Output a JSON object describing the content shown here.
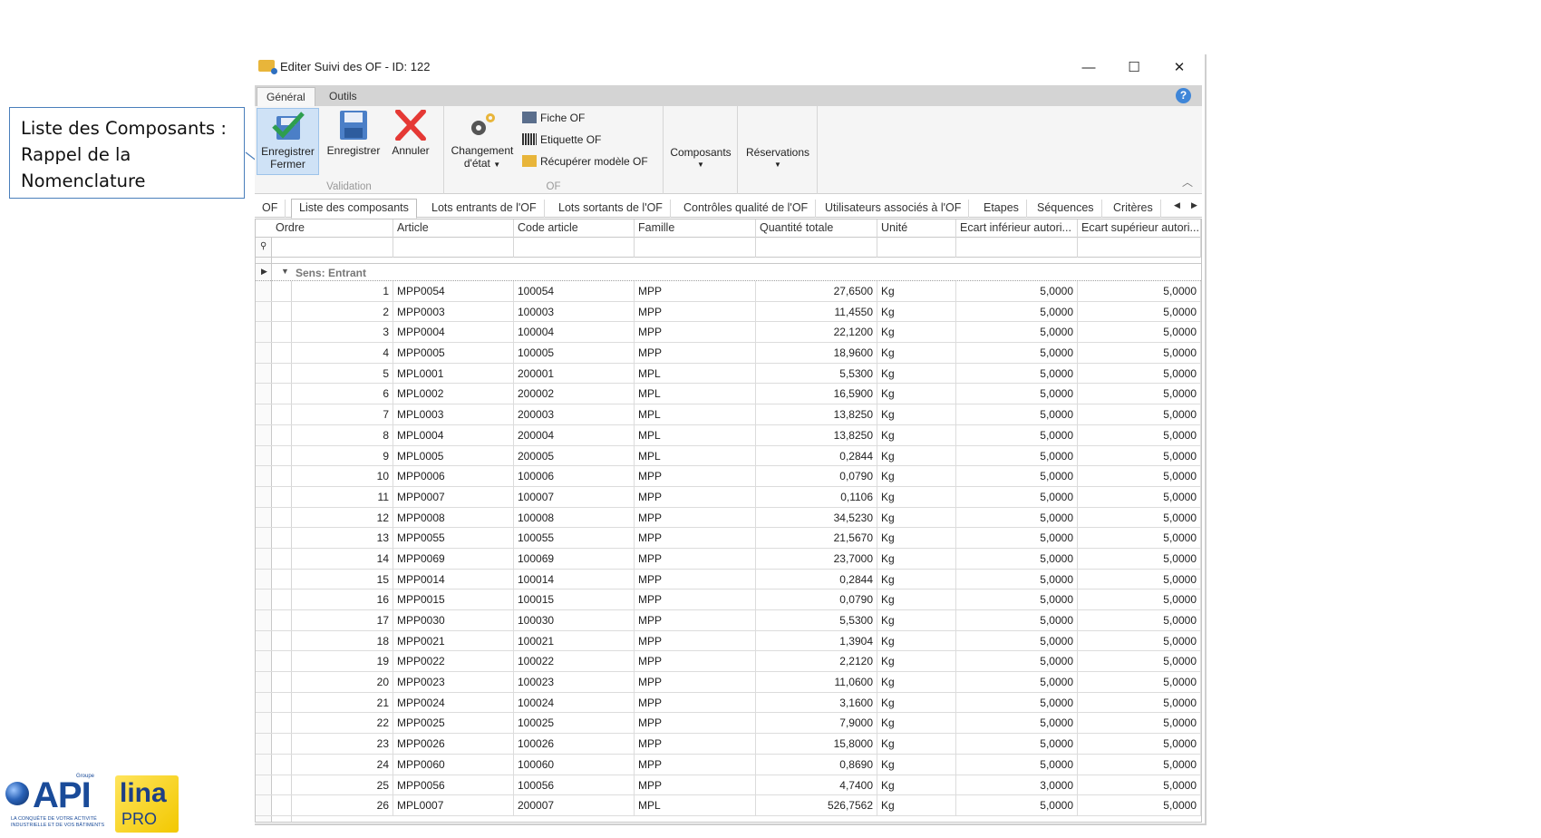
{
  "callout": {
    "line1": "Liste des Composants :",
    "line2": "Rappel de la",
    "line3": "Nomenclature"
  },
  "window": {
    "title": "Editer Suivi des OF - ID: 122",
    "minimize": "—",
    "maximize": "☐",
    "close": "✕"
  },
  "ribbon_tabs": [
    "Général",
    "Outils"
  ],
  "ribbon": {
    "save_close_l1": "Enregistrer",
    "save_close_l2": "Fermer",
    "save": "Enregistrer",
    "cancel": "Annuler",
    "validation_group": "Validation",
    "change_state_l1": "Changement",
    "change_state_l2": "d'état",
    "fiche_of": "Fiche OF",
    "etiquette_of": "Etiquette OF",
    "recuperer": "Récupérer modèle OF",
    "of_group": "OF",
    "composants": "Composants",
    "reservations": "Réservations"
  },
  "page_tabs": [
    "OF",
    "Liste des composants",
    "Lots entrants de l'OF",
    "Lots sortants de l'OF",
    "Contrôles qualité de l'OF",
    "Utilisateurs associés à l'OF",
    "Etapes",
    "Séquences",
    "Critères"
  ],
  "grid": {
    "columns": [
      "Ordre",
      "Article",
      "Code article",
      "Famille",
      "Quantité totale",
      "Unité",
      "Ecart inférieur autori...",
      "Ecart supérieur autori..."
    ],
    "group_label": "Sens: Entrant",
    "rows": [
      [
        "1",
        "MPP0054",
        "100054",
        "MPP",
        "27,6500",
        "Kg",
        "5,0000",
        "5,0000"
      ],
      [
        "2",
        "MPP0003",
        "100003",
        "MPP",
        "11,4550",
        "Kg",
        "5,0000",
        "5,0000"
      ],
      [
        "3",
        "MPP0004",
        "100004",
        "MPP",
        "22,1200",
        "Kg",
        "5,0000",
        "5,0000"
      ],
      [
        "4",
        "MPP0005",
        "100005",
        "MPP",
        "18,9600",
        "Kg",
        "5,0000",
        "5,0000"
      ],
      [
        "5",
        "MPL0001",
        "200001",
        "MPL",
        "5,5300",
        "Kg",
        "5,0000",
        "5,0000"
      ],
      [
        "6",
        "MPL0002",
        "200002",
        "MPL",
        "16,5900",
        "Kg",
        "5,0000",
        "5,0000"
      ],
      [
        "7",
        "MPL0003",
        "200003",
        "MPL",
        "13,8250",
        "Kg",
        "5,0000",
        "5,0000"
      ],
      [
        "8",
        "MPL0004",
        "200004",
        "MPL",
        "13,8250",
        "Kg",
        "5,0000",
        "5,0000"
      ],
      [
        "9",
        "MPL0005",
        "200005",
        "MPL",
        "0,2844",
        "Kg",
        "5,0000",
        "5,0000"
      ],
      [
        "10",
        "MPP0006",
        "100006",
        "MPP",
        "0,0790",
        "Kg",
        "5,0000",
        "5,0000"
      ],
      [
        "11",
        "MPP0007",
        "100007",
        "MPP",
        "0,1106",
        "Kg",
        "5,0000",
        "5,0000"
      ],
      [
        "12",
        "MPP0008",
        "100008",
        "MPP",
        "34,5230",
        "Kg",
        "5,0000",
        "5,0000"
      ],
      [
        "13",
        "MPP0055",
        "100055",
        "MPP",
        "21,5670",
        "Kg",
        "5,0000",
        "5,0000"
      ],
      [
        "14",
        "MPP0069",
        "100069",
        "MPP",
        "23,7000",
        "Kg",
        "5,0000",
        "5,0000"
      ],
      [
        "15",
        "MPP0014",
        "100014",
        "MPP",
        "0,2844",
        "Kg",
        "5,0000",
        "5,0000"
      ],
      [
        "16",
        "MPP0015",
        "100015",
        "MPP",
        "0,0790",
        "Kg",
        "5,0000",
        "5,0000"
      ],
      [
        "17",
        "MPP0030",
        "100030",
        "MPP",
        "5,5300",
        "Kg",
        "5,0000",
        "5,0000"
      ],
      [
        "18",
        "MPP0021",
        "100021",
        "MPP",
        "1,3904",
        "Kg",
        "5,0000",
        "5,0000"
      ],
      [
        "19",
        "MPP0022",
        "100022",
        "MPP",
        "2,2120",
        "Kg",
        "5,0000",
        "5,0000"
      ],
      [
        "20",
        "MPP0023",
        "100023",
        "MPP",
        "11,0600",
        "Kg",
        "5,0000",
        "5,0000"
      ],
      [
        "21",
        "MPP0024",
        "100024",
        "MPP",
        "3,1600",
        "Kg",
        "5,0000",
        "5,0000"
      ],
      [
        "22",
        "MPP0025",
        "100025",
        "MPP",
        "7,9000",
        "Kg",
        "5,0000",
        "5,0000"
      ],
      [
        "23",
        "MPP0026",
        "100026",
        "MPP",
        "15,8000",
        "Kg",
        "5,0000",
        "5,0000"
      ],
      [
        "24",
        "MPP0060",
        "100060",
        "MPP",
        "0,8690",
        "Kg",
        "5,0000",
        "5,0000"
      ],
      [
        "25",
        "MPP0056",
        "100056",
        "MPP",
        "4,7400",
        "Kg",
        "3,0000",
        "5,0000"
      ],
      [
        "26",
        "MPL0007",
        "200007",
        "MPL",
        "526,7562",
        "Kg",
        "5,0000",
        "5,0000"
      ]
    ]
  },
  "logos": {
    "api": "API",
    "api_groupe": "Groupe",
    "api_tagline": "LA CONQUÊTE DE VOTRE ACTIVITÉ INDUSTRIELLE ET DE VOS BÂTIMENTS",
    "lina": "lina",
    "pro": "PRO"
  },
  "colors": {
    "accent_blue": "#3f86d8",
    "selected_tab": "#cfe2f6",
    "cancel_red": "#e53935",
    "check_green": "#2e9e4f"
  }
}
